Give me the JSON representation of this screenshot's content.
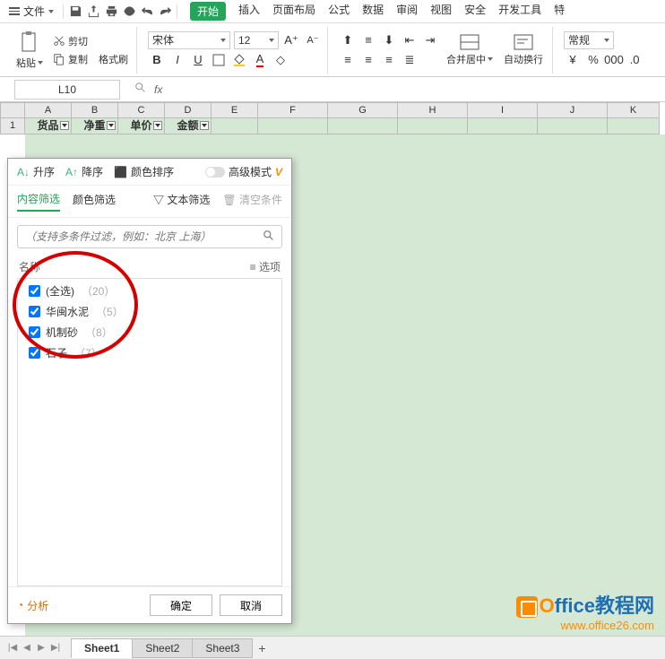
{
  "menubar": {
    "file_label": "文件",
    "tabs": [
      "开始",
      "插入",
      "页面布局",
      "公式",
      "数据",
      "审阅",
      "视图",
      "安全",
      "开发工具",
      "特"
    ],
    "active_tab": "开始"
  },
  "ribbon": {
    "paste_label": "粘贴",
    "cut_label": "剪切",
    "copy_label": "复制",
    "format_painter_label": "格式刷",
    "font_name": "宋体",
    "font_size": "12",
    "merge_center_label": "合并居中",
    "auto_wrap_label": "自动换行",
    "style_label": "常规"
  },
  "formula_bar": {
    "cell_ref": "L10",
    "fx_label": "fx"
  },
  "columns": [
    "A",
    "B",
    "C",
    "D",
    "E",
    "F",
    "G",
    "H",
    "I",
    "J",
    "K"
  ],
  "header_row": {
    "row_num": "1",
    "cells": [
      "货品",
      "净重",
      "单价",
      "金额"
    ]
  },
  "filter_panel": {
    "sort_asc": "升序",
    "sort_desc": "降序",
    "color_sort": "颜色排序",
    "advanced_mode": "高级模式",
    "tabs": {
      "content_filter": "内容筛选",
      "color_filter": "颜色筛选",
      "text_filter": "文本筛选",
      "clear": "清空条件"
    },
    "search_placeholder": "（支持多条件过滤，例如：北京 上海）",
    "name_heading": "名称",
    "options_label": "选项",
    "items": [
      {
        "label": "(全选)",
        "count": "（20）",
        "checked": true
      },
      {
        "label": "华闽水泥",
        "count": "（5）",
        "checked": true
      },
      {
        "label": "机制砂",
        "count": "（8）",
        "checked": true
      },
      {
        "label": "石子",
        "count": "（7）",
        "checked": true
      }
    ],
    "analyze_label": "分析",
    "ok_label": "确定",
    "cancel_label": "取消"
  },
  "sheet_tabs": [
    "Sheet1",
    "Sheet2",
    "Sheet3"
  ],
  "active_sheet": "Sheet1",
  "watermark": {
    "title_prefix": "O",
    "title_rest": "ffice教程网",
    "url": "www.office26.com"
  }
}
